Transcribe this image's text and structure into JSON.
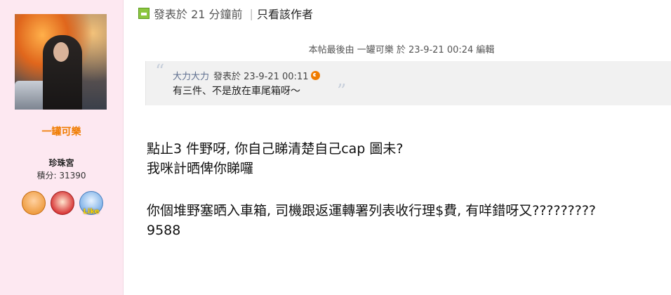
{
  "sidebar": {
    "poster_name": "一罐可樂",
    "rank_name": "珍珠宮",
    "credits": "積分: 31390",
    "medals": [
      "medal-1",
      "medal-2",
      "medal-3"
    ],
    "medal_3_label": "Like",
    "accent_color": "#f07c00",
    "background_color": "#fde8f1"
  },
  "meta_bar": {
    "post_time": "發表於 21 分鐘前",
    "separator": "|",
    "only_author": "只看該作者"
  },
  "edit_note": "本帖最後由 一罐可樂 於 23-9-21 00:24 編輯",
  "quote": {
    "open_mark": "“",
    "author": "大力大力",
    "posted": "發表於 23-9-21 00:11",
    "text": "有三件、不是放在車尾箱呀～",
    "close_mark": "”"
  },
  "post_body": {
    "line1": "點止3 件野呀, 你自己睇清楚自己cap 圖未?",
    "line2": "我咪計晒俾你睇囉",
    "line3": "你個堆野塞晒入車箱, 司機跟返運轉署列表收行理$費, 有咩錯呀又?????????",
    "line4": "9588"
  }
}
